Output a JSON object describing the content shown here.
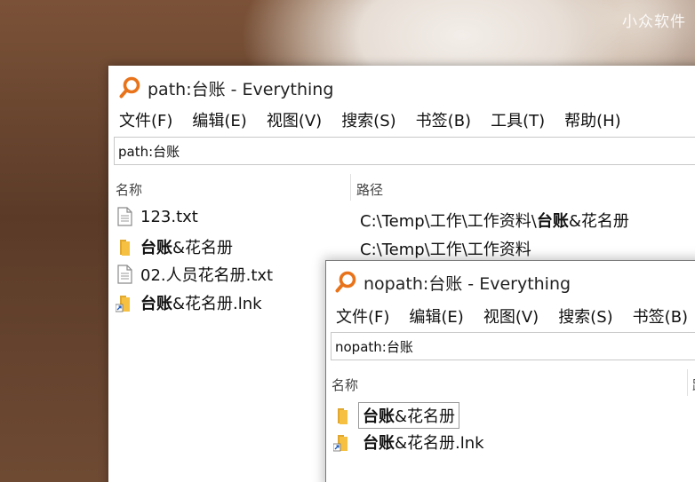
{
  "watermark": "小众软件",
  "window1": {
    "title": "path:台账 - Everything",
    "menu": [
      "文件(F)",
      "编辑(E)",
      "视图(V)",
      "搜索(S)",
      "书签(B)",
      "工具(T)",
      "帮助(H)"
    ],
    "search_value": "path:台账",
    "columns": {
      "name": "名称",
      "path": "路径"
    },
    "rows": [
      {
        "icon": "text-file-icon",
        "name_pre": "123.txt",
        "name_bold": "",
        "name_post": "",
        "path_pre": "C:\\Temp\\工作\\工作资料\\",
        "path_bold": "台账",
        "path_post": "&花名册"
      },
      {
        "icon": "folder-icon",
        "name_pre": "",
        "name_bold": "台账",
        "name_post": "&花名册",
        "path_pre": "C:\\Temp\\工作\\工作资料",
        "path_bold": "",
        "path_post": ""
      },
      {
        "icon": "text-file-icon",
        "name_pre": "02.人员花名册.txt",
        "name_bold": "",
        "name_post": "",
        "path_pre": "",
        "path_bold": "",
        "path_post": ""
      },
      {
        "icon": "folder-shortcut-icon",
        "name_pre": "",
        "name_bold": "台账",
        "name_post": "&花名册.lnk",
        "path_pre": "",
        "path_bold": "",
        "path_post": ""
      }
    ]
  },
  "window2": {
    "title": "nopath:台账 - Everything",
    "menu": [
      "文件(F)",
      "编辑(E)",
      "视图(V)",
      "搜索(S)",
      "书签(B)"
    ],
    "search_value": "nopath:台账",
    "columns": {
      "name": "名称",
      "path": "路"
    },
    "rows": [
      {
        "icon": "folder-icon",
        "name_bold": "台账",
        "name_post": "&花名册"
      },
      {
        "icon": "folder-shortcut-icon",
        "name_bold": "台账",
        "name_post": "&花名册.lnk"
      }
    ]
  },
  "colors": {
    "accent": "#e8731a",
    "folder": "#f6c142"
  }
}
